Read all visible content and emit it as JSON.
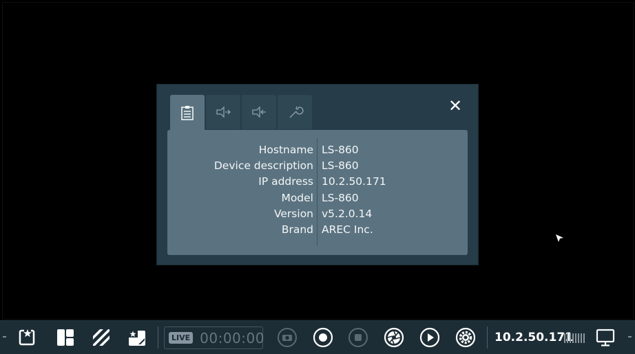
{
  "dialog": {
    "tabs": [
      {
        "name": "tab-info",
        "icon": "clipboard-icon",
        "active": true
      },
      {
        "name": "tab-input",
        "icon": "input-plug-icon",
        "active": false
      },
      {
        "name": "tab-output",
        "icon": "output-plug-icon",
        "active": false
      },
      {
        "name": "tab-tools",
        "icon": "wrench-icon",
        "active": false
      }
    ],
    "close_label": "✕",
    "info": [
      {
        "key": "Hostname",
        "value": "LS-860"
      },
      {
        "key": "Device description",
        "value": "LS-860"
      },
      {
        "key": "IP address",
        "value": "10.2.50.171"
      },
      {
        "key": "Model",
        "value": "LS-860"
      },
      {
        "key": "Version",
        "value": "v5.2.0.14"
      },
      {
        "key": "Brand",
        "value": "AREC Inc."
      }
    ]
  },
  "taskbar": {
    "live_badge": "LIVE",
    "timer": "00:00:00",
    "ip": "10.2.50.171",
    "icons": [
      "layout-star-icon",
      "layout-split-icon",
      "stripes-icon",
      "layout-window-icon",
      "camera-icon",
      "record-icon",
      "stop-icon",
      "aperture-icon",
      "play-icon",
      "gear-icon",
      "monitor-icon"
    ]
  },
  "colors": {
    "dialog_bg": "#263c48",
    "panel_bg": "#5b7380",
    "taskbar_bg": "#1d2d36"
  }
}
